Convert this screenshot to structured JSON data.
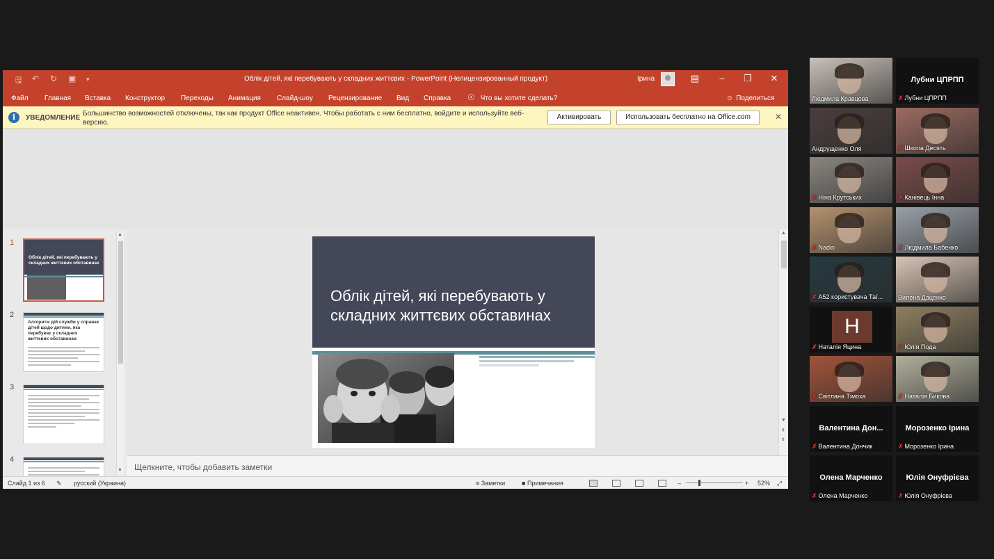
{
  "powerpoint": {
    "title": "Облік дітей, які перебувають у складних життєвих  -  PowerPoint (Нелицензированный продукт)",
    "user": "Ірина",
    "ribbon_tabs": [
      "Файл",
      "Главная",
      "Вставка",
      "Конструктор",
      "Переходы",
      "Анимация",
      "Слайд-шоу",
      "Рецензирование",
      "Вид",
      "Справка"
    ],
    "tell_me": "Что вы хотите сделать?",
    "share": "Поделиться",
    "notice": {
      "label": "УВЕДОМЛЕНИЕ",
      "message": "Большинство возможностей отключены, так как продукт Office неактивен. Чтобы работать с ним бесплатно, войдите и используйте веб-версию.",
      "activate_button": "Активировать",
      "free_button": "Использовать бесплатно на Office.com"
    },
    "thumbnails": [
      {
        "num": "1",
        "title": "Облік дітей, які перебувають у складних життєвих обставинах"
      },
      {
        "num": "2",
        "title": "Алгоритм дій служби у справах дітей щодо дитини, яка перебуває у складних життєвих обставинах:"
      },
      {
        "num": "3",
        "title": ""
      },
      {
        "num": "4",
        "title": ""
      }
    ],
    "slide_title": "Облік дітей, які перебувають у складних життєвих обставинах",
    "notes_placeholder": "Щелкните, чтобы добавить заметки",
    "status": {
      "slide_info": "Слайд 1 из 6",
      "language": "русский (Украина)",
      "notes": "Заметки",
      "comments": "Примечания",
      "zoom": "52%"
    }
  },
  "participants": [
    {
      "name": "Людмила Кравцова",
      "big": "",
      "muted": false,
      "video": true,
      "bg": "#c9c1b9"
    },
    {
      "name": "Лубни ЦПРПП",
      "big": "Лубни ЦПРПП",
      "muted": true,
      "video": false,
      "bg": "#1b1b1b"
    },
    {
      "name": "Андрущенко Оля",
      "big": "",
      "muted": false,
      "video": true,
      "bg": "#4a3e3d"
    },
    {
      "name": "Школа Десять",
      "big": "",
      "muted": true,
      "video": true,
      "bg": "#9c6b60"
    },
    {
      "name": "Ніна Крутських",
      "big": "",
      "muted": true,
      "video": true,
      "bg": "#8a8580"
    },
    {
      "name": "Канівець Інна",
      "big": "",
      "muted": true,
      "video": true,
      "bg": "#7a4b48"
    },
    {
      "name": "Nadin",
      "big": "",
      "muted": true,
      "video": true,
      "bg": "#b4926f"
    },
    {
      "name": "Людмила Бабенко",
      "big": "",
      "muted": true,
      "video": true,
      "bg": "#9aa0a8"
    },
    {
      "name": "А52 користувача Таї...",
      "big": "",
      "muted": true,
      "video": true,
      "bg": "#263a40"
    },
    {
      "name": "Вилена Даценко",
      "big": "",
      "muted": false,
      "video": true,
      "bg": "#d7c3b3"
    },
    {
      "name": "Наталія Яцина",
      "big": "",
      "muted": true,
      "video": false,
      "bg": "#1b1b1b",
      "letter": "Н"
    },
    {
      "name": "Юлія Пода",
      "big": "",
      "muted": true,
      "video": true,
      "bg": "#8d8060"
    },
    {
      "name": "Світлана Тімоха",
      "big": "",
      "muted": true,
      "video": true,
      "bg": "#a2533a"
    },
    {
      "name": "Наталія Бикова",
      "big": "",
      "muted": true,
      "video": true,
      "bg": "#b0b09e"
    },
    {
      "name": "Валентина Дончик",
      "big": "Валентина  Дон...",
      "muted": true,
      "video": false,
      "bg": "#1b1b1b"
    },
    {
      "name": "Морозенко Ірина",
      "big": "Морозенко Ірина",
      "muted": true,
      "video": false,
      "bg": "#1b1b1b"
    },
    {
      "name": "Олена Марченко",
      "big": "Олена Марченко",
      "muted": true,
      "video": false,
      "bg": "#1b1b1b"
    },
    {
      "name": "Юлія Онуфрієва",
      "big": "Юлія Онуфрієва",
      "muted": true,
      "video": false,
      "bg": "#1b1b1b"
    }
  ]
}
